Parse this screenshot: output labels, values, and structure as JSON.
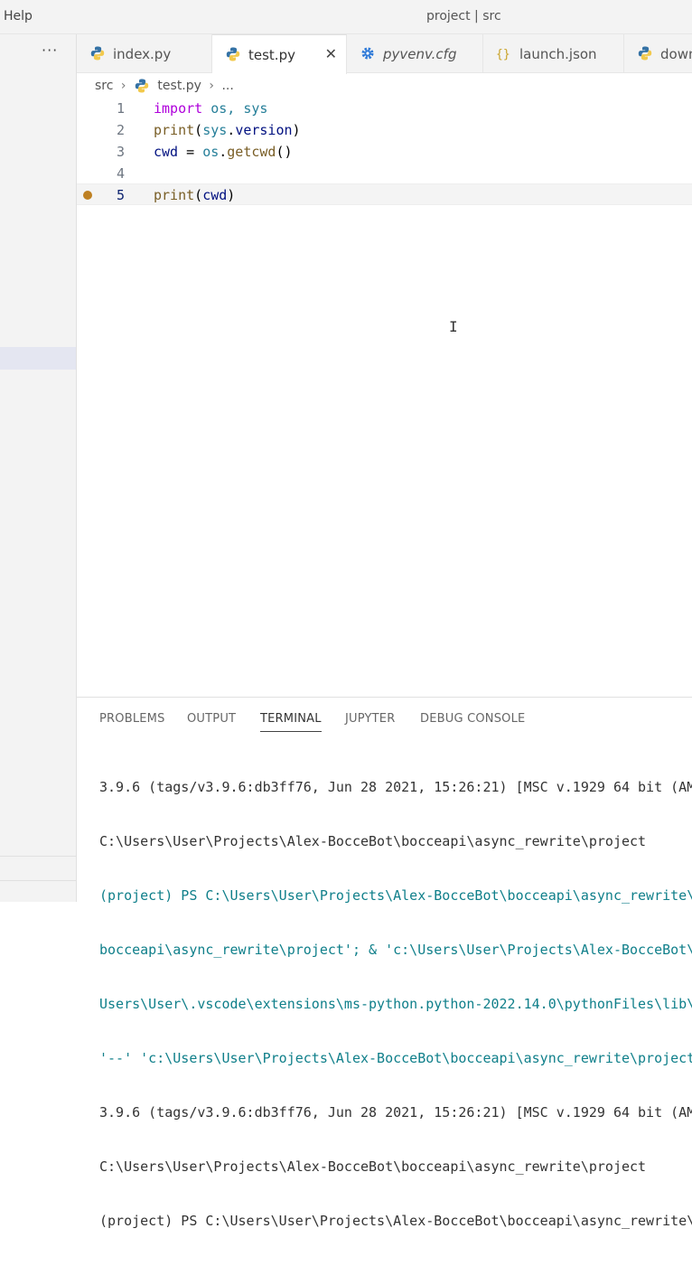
{
  "titlebar": {
    "menu_help": "Help",
    "window_title": "project | src"
  },
  "sidebar": {
    "more_label": "···"
  },
  "tabs": [
    {
      "label": "index.py",
      "icon": "python-icon",
      "active": false
    },
    {
      "label": "test.py",
      "icon": "python-icon",
      "active": true,
      "close": "✕"
    },
    {
      "label": "pyvenv.cfg",
      "icon": "gear-icon",
      "active": false
    },
    {
      "label": "launch.json",
      "icon": "json-icon",
      "active": false
    },
    {
      "label": "down",
      "icon": "python-icon",
      "active": false
    }
  ],
  "breadcrumb": {
    "folder": "src",
    "file": "test.py",
    "ellipsis": "..."
  },
  "editor": {
    "lines": [
      {
        "num": "1"
      },
      {
        "num": "2"
      },
      {
        "num": "3"
      },
      {
        "num": "4"
      },
      {
        "num": "5"
      }
    ],
    "code": {
      "l1_kw": "import",
      "l1_rest": " os, sys",
      "l2_fn": "print",
      "l2_p1": "(",
      "l2_mod": "sys",
      "l2_dot": ".",
      "l2_attr": "version",
      "l2_p2": ")",
      "l3_var": "cwd",
      "l3_eq": " = ",
      "l3_mod": "os",
      "l3_dot": ".",
      "l3_fn": "getcwd",
      "l3_paren": "()",
      "l5_fn": "print",
      "l5_p1": "(",
      "l5_var": "cwd",
      "l5_p2": ")"
    },
    "breakpoint_line": "5",
    "cursor_glyph": "I"
  },
  "panel": {
    "tabs": [
      "PROBLEMS",
      "OUTPUT",
      "TERMINAL",
      "JUPYTER",
      "DEBUG CONSOLE"
    ],
    "active_tab": "TERMINAL",
    "terminal_lines": [
      "3.9.6 (tags/v3.9.6:db3ff76, Jun 28 2021, 15:26:21) [MSC v.1929 64 bit (AM",
      "C:\\Users\\User\\Projects\\Alex-BocceBot\\bocceapi\\async_rewrite\\project",
      "(project) PS C:\\Users\\User\\Projects\\Alex-BocceBot\\bocceapi\\async_rewrite\\",
      "bocceapi\\async_rewrite\\project'; & 'c:\\Users\\User\\Projects\\Alex-BocceBot\\",
      "Users\\User\\.vscode\\extensions\\ms-python.python-2022.14.0\\pythonFiles\\lib\\",
      "'--' 'c:\\Users\\User\\Projects\\Alex-BocceBot\\bocceapi\\async_rewrite\\project",
      "3.9.6 (tags/v3.9.6:db3ff76, Jun 28 2021, 15:26:21) [MSC v.1929 64 bit (AM",
      "C:\\Users\\User\\Projects\\Alex-BocceBot\\bocceapi\\async_rewrite\\project",
      "(project) PS C:\\Users\\User\\Projects\\Alex-BocceBot\\bocceapi\\async_rewrite\\"
    ]
  },
  "colors": {
    "keyword": "#af00db",
    "function": "#795e26",
    "variable": "#001080",
    "module": "#267f99",
    "breakpoint": "#be8022",
    "terminal_path_teal": "#0f7f8a"
  }
}
